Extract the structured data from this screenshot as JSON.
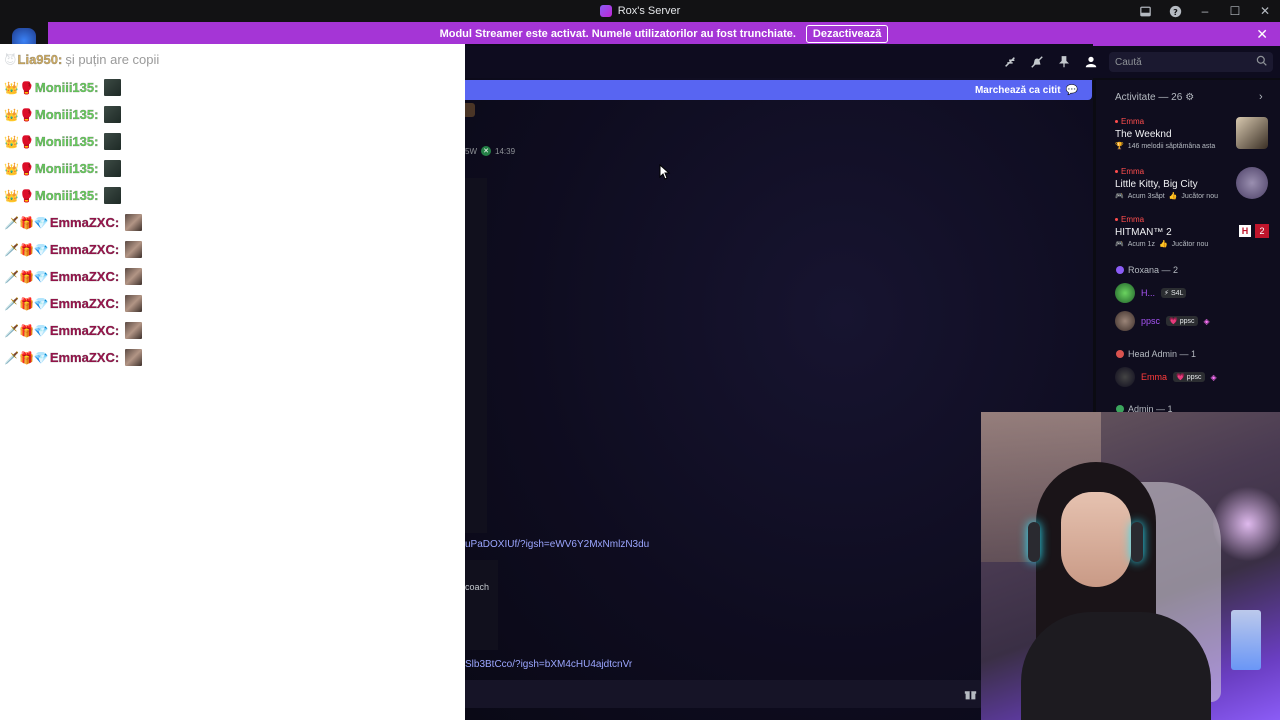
{
  "window": {
    "title": "Rox's Server"
  },
  "banner": {
    "text": "Modul Streamer este activat. Numele utilizatorilor au fost trunchiate.",
    "button": "Dezactivează"
  },
  "toolbar": {
    "search_placeholder": "Caută"
  },
  "channel": {
    "mark_read": "Marchează ca citit",
    "meta_name": "5W",
    "meta_time": "14:39",
    "link1": "uPaDOXIUf/?igsh=eWV6Y2MxNmlzN3du",
    "coach": "coach",
    "link2": "Slb3BtCco/?igsh=bXM4cHU4ajdtcnVr"
  },
  "members": {
    "activity_header": "Activitate — 26",
    "activities": [
      {
        "user": "Emma",
        "title": "The Weeknd",
        "sub": "146 melodii săptămâna asta"
      },
      {
        "user": "Emma",
        "title": "Little Kitty, Big City",
        "sub1": "Acum 3săpt",
        "sub2": "Jucător nou"
      },
      {
        "user": "Emma",
        "title": "HITMAN™ 2",
        "sub1": "Acum 1z",
        "sub2": "Jucător nou",
        "badge_letter": "H",
        "badge_count": "2"
      }
    ],
    "roles": [
      {
        "name": "Roxana — 2",
        "color": "#8b5cf6"
      },
      {
        "name": "Head Admin — 1",
        "color": "#d9534f"
      },
      {
        "name": "Admin — 1",
        "color": "#3ba55d"
      }
    ],
    "member_list": [
      {
        "name": "H...",
        "tag": "S4L",
        "color": "#a855f7"
      },
      {
        "name": "ppsc",
        "tag": "ppsc",
        "color": "#a855f7"
      },
      {
        "name": "Emma",
        "tag": "ppsc",
        "color": "#ff3b3b"
      }
    ]
  },
  "chat": {
    "lines": [
      {
        "badges": "😈",
        "user": "Lia950:",
        "msg": "și puțin are copii",
        "color": "#d4b062"
      },
      {
        "badges": "👑🥊",
        "user": "Moniii135:",
        "msg": "",
        "color": "#6ad35f"
      },
      {
        "badges": "👑🥊",
        "user": "Moniii135:",
        "msg": "",
        "color": "#6ad35f"
      },
      {
        "badges": "👑🥊",
        "user": "Moniii135:",
        "msg": "",
        "color": "#6ad35f"
      },
      {
        "badges": "👑🥊",
        "user": "Moniii135:",
        "msg": "",
        "color": "#6ad35f"
      },
      {
        "badges": "👑🥊",
        "user": "Moniii135:",
        "msg": "",
        "color": "#6ad35f"
      },
      {
        "badges": "🗡️🎁💎",
        "user": "EmmaZXC:",
        "msg": "",
        "color": "#a0144f"
      },
      {
        "badges": "🗡️🎁💎",
        "user": "EmmaZXC:",
        "msg": "",
        "color": "#a0144f"
      },
      {
        "badges": "🗡️🎁💎",
        "user": "EmmaZXC:",
        "msg": "",
        "color": "#a0144f"
      },
      {
        "badges": "🗡️🎁💎",
        "user": "EmmaZXC:",
        "msg": "",
        "color": "#a0144f"
      },
      {
        "badges": "🗡️🎁💎",
        "user": "EmmaZXC:",
        "msg": "",
        "color": "#a0144f"
      },
      {
        "badges": "🗡️🎁💎",
        "user": "EmmaZXC:",
        "msg": "",
        "color": "#a0144f"
      }
    ]
  }
}
